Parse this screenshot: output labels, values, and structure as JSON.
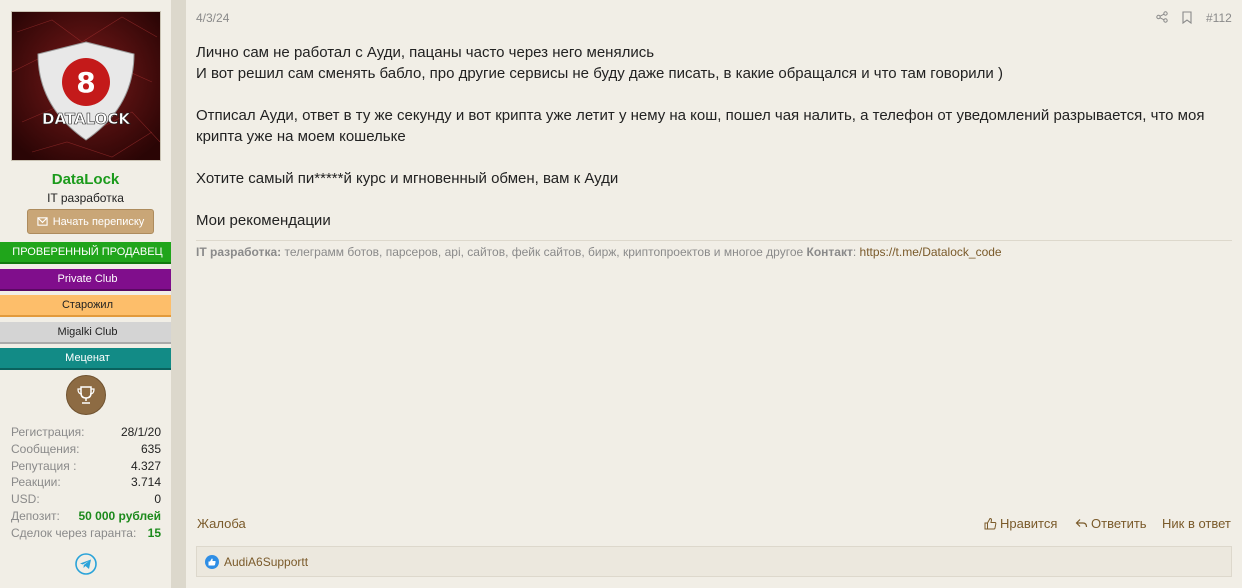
{
  "user": {
    "avatar_text": "DATALOCK",
    "name": "DataLock",
    "title": "IT разработка",
    "start_conversation_label": "Начать переписку",
    "banners": [
      "ПРОВЕРЕННЫЙ ПРОДАВЕЦ",
      "Private Club",
      "Старожил",
      "Migalki Club",
      "Меценат"
    ],
    "stats": [
      {
        "key": "Регистрация:",
        "value": "28/1/20"
      },
      {
        "key": "Сообщения:",
        "value": "635"
      },
      {
        "key": "Репутация :",
        "value": "4.327"
      },
      {
        "key": "Реакции:",
        "value": "3.714"
      },
      {
        "key": "USD:",
        "value": "0"
      },
      {
        "key": "Депозит:",
        "value": "50 000 рублей"
      },
      {
        "key": "Сделок через гаранта:",
        "value": "15"
      }
    ]
  },
  "post": {
    "date": "4/3/24",
    "number": "#112",
    "lines": [
      "Лично сам не работал с Ауди, пацаны часто через него менялись",
      "И вот решил сам сменять бабло, про другие сервисы не буду даже писать, в какие обращался и что там говорили )",
      "Отписал Ауди, ответ в ту же секунду и вот крипта уже летит у нему на кош, пошел чая налить, а телефон от уведомлений разрывается, что моя крипта уже на моем кошельке",
      "Хотите самый пи*****й курс и мгновенный обмен, вам к Ауди",
      "Мои рекомендации"
    ],
    "signature": {
      "label1": "IT разработка:",
      "text1": " телеграмм ботов, парсеров, api, сайтов, фейк сайтов, бирж, криптопроектов и многое другое ",
      "label2": "Контакт",
      "sep": ": ",
      "link": "https://t.me/Datalock_code"
    },
    "footer": {
      "report": "Жалоба",
      "like": "Нравится",
      "reply": "Ответить",
      "nick": "Ник в ответ"
    },
    "reactions_user": "AudiA6Supportt"
  },
  "colors": {
    "accent": "#7a5a2a",
    "verified": "#20a51b",
    "private_club": "#800e8c",
    "old_timer": "#fdbe6a",
    "migalki": "#d4d4d4",
    "patron": "#128b86"
  }
}
